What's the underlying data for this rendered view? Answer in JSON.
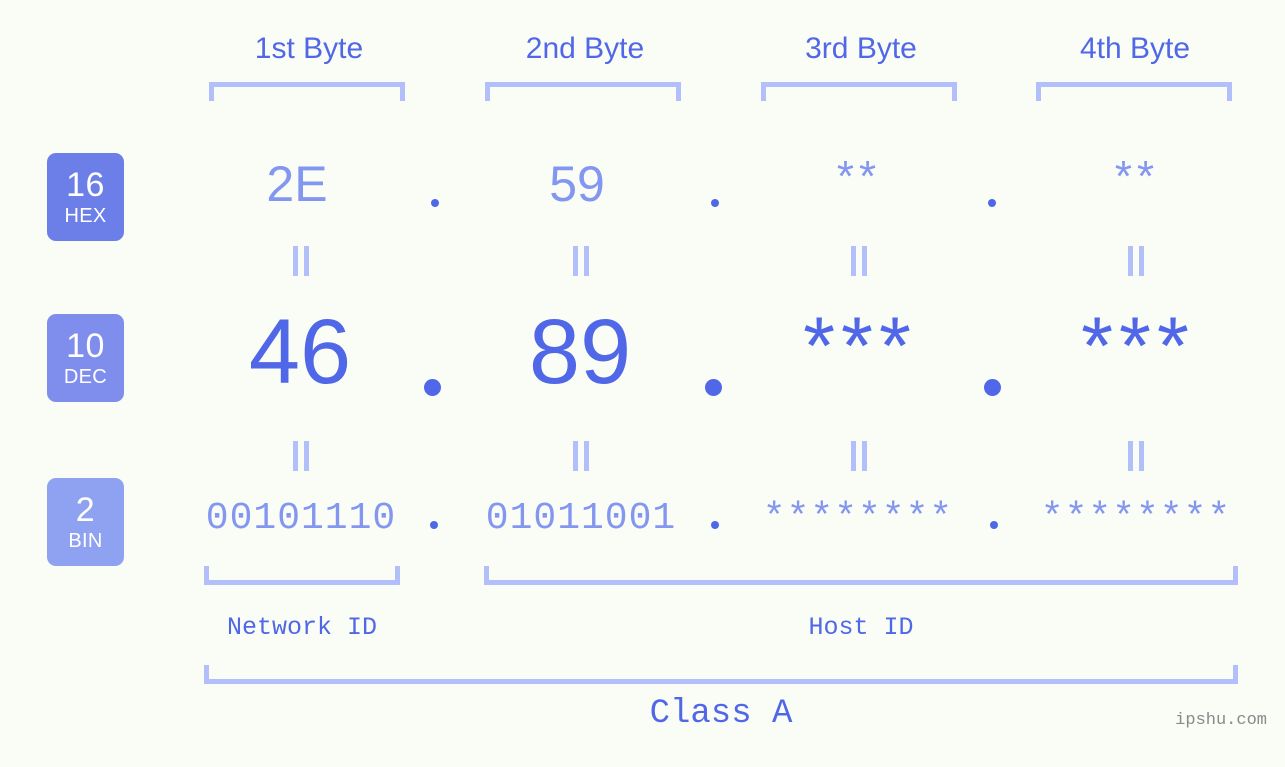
{
  "theme": {
    "background": "#fafcf6",
    "accent_strong": "#5067e8",
    "accent_mid": "#8497f0",
    "accent_light": "#b3bffa",
    "badge_hex": "#6c7fe9",
    "badge_dec": "#7f8eed",
    "badge_bin": "#8fa2f2",
    "watermark": "#8a8a8a"
  },
  "columns": [
    {
      "label": "1st Byte"
    },
    {
      "label": "2nd Byte"
    },
    {
      "label": "3rd Byte"
    },
    {
      "label": "4th Byte"
    }
  ],
  "rows": [
    {
      "base": "16",
      "system": "HEX",
      "values": [
        "2E",
        "59",
        "**",
        "**"
      ],
      "separator": "."
    },
    {
      "base": "10",
      "system": "DEC",
      "values": [
        "46",
        "89",
        "***",
        "***"
      ],
      "separator": "."
    },
    {
      "base": "2",
      "system": "BIN",
      "values": [
        "00101110",
        "01011001",
        "********",
        "********"
      ],
      "separator": "."
    }
  ],
  "equality_mark": "||",
  "segments": [
    {
      "label": "Network ID"
    },
    {
      "label": "Host ID"
    }
  ],
  "class": {
    "label": "Class A"
  },
  "watermark": {
    "text": "ipshu.com"
  }
}
